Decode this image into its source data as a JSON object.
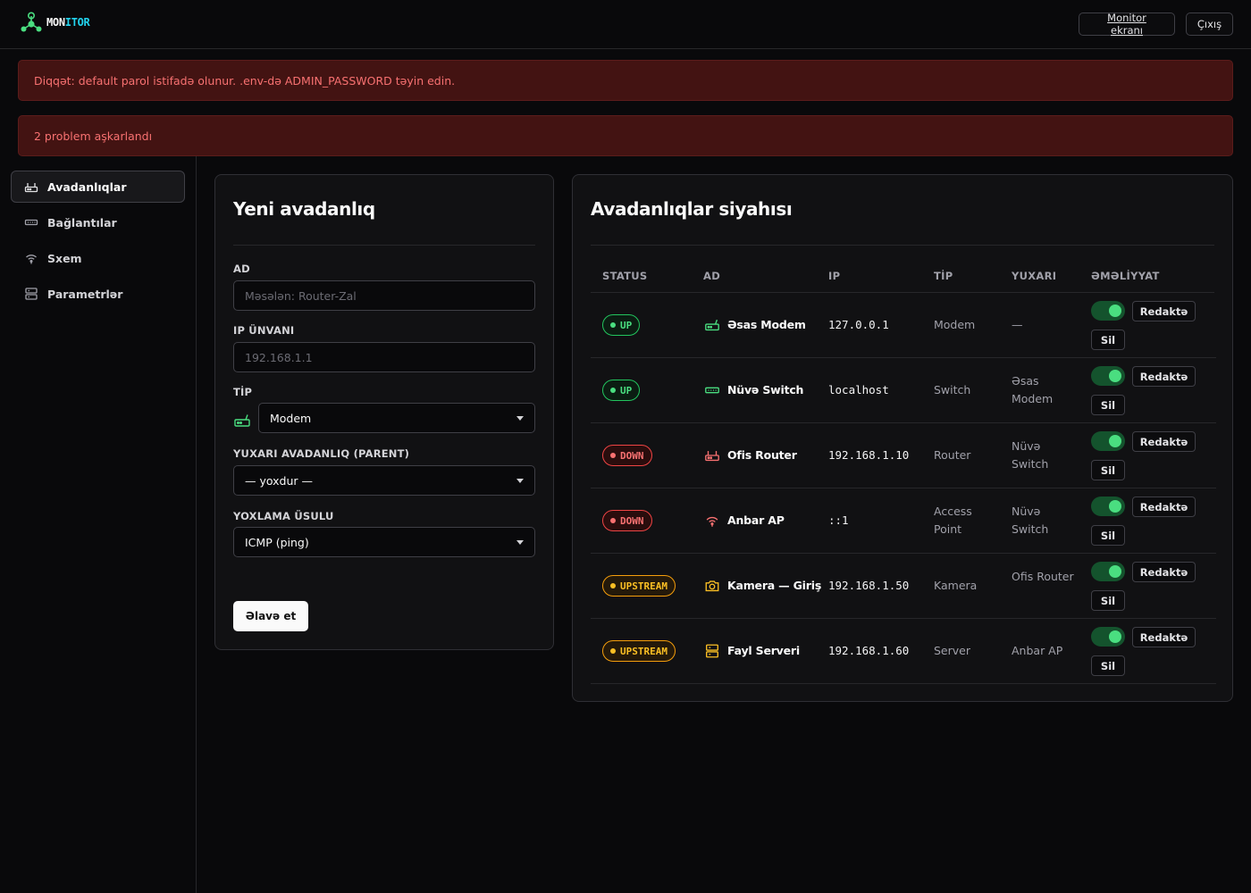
{
  "app": {
    "logo_part1": "MON",
    "logo_part2": "ITOR"
  },
  "topbar": {
    "monitor_label": "Monitor ekranı",
    "logout_label": "Çıxış"
  },
  "alerts": [
    "Diqqət: default parol istifadə olunur. .env-də ADMIN_PASSWORD təyin edin.",
    "2 problem aşkarlandı"
  ],
  "sidebar": {
    "items": [
      {
        "label": "Avadanlıqlar",
        "icon": "router-icon",
        "active": true
      },
      {
        "label": "Bağlantılar",
        "icon": "switch-icon",
        "active": false
      },
      {
        "label": "Sxem",
        "icon": "wifi-icon",
        "active": false
      },
      {
        "label": "Parametrlər",
        "icon": "server-icon",
        "active": false
      }
    ]
  },
  "form": {
    "title": "Yeni avadanlıq",
    "name_label": "AD",
    "name_placeholder": "Məsələn: Router-Zal",
    "ip_label": "IP ÜNVANI",
    "ip_placeholder": "192.168.1.1",
    "type_label": "TİP",
    "type_value": "Modem",
    "parent_label": "YUXARI AVADANLIQ (PARENT)",
    "parent_value": "— yoxdur —",
    "check_label": "YOXLAMA ÜSULU",
    "check_value": "ICMP (ping)",
    "submit_label": "Əlavə et"
  },
  "list": {
    "title": "Avadanlıqlar siyahısı",
    "columns": [
      "STATUS",
      "AD",
      "IP",
      "TİP",
      "YUXARI",
      "ƏMƏLİYYAT"
    ],
    "edit_label": "Redaktə",
    "delete_label": "Sil",
    "rows": [
      {
        "status": "UP",
        "status_kind": "up",
        "name": "Əsas Modem",
        "icon": "modem-icon",
        "ip": "127.0.0.1",
        "type": "Modem",
        "parent": "—",
        "enabled": true
      },
      {
        "status": "UP",
        "status_kind": "up",
        "name": "Nüvə Switch",
        "icon": "switch-icon",
        "ip": "localhost",
        "type": "Switch",
        "parent": "Əsas Modem",
        "enabled": true
      },
      {
        "status": "DOWN",
        "status_kind": "down",
        "name": "Ofis Router",
        "icon": "router-icon",
        "ip": "192.168.1.10",
        "type": "Router",
        "parent": "Nüvə Switch",
        "enabled": true
      },
      {
        "status": "DOWN",
        "status_kind": "down",
        "name": "Anbar AP",
        "icon": "wifi-icon",
        "ip": "::1",
        "type": "Access Point",
        "parent": "Nüvə Switch",
        "enabled": true
      },
      {
        "status": "UPSTREAM",
        "status_kind": "upstream",
        "name": "Kamera — Giriş",
        "icon": "camera-icon",
        "ip": "192.168.1.50",
        "type": "Kamera",
        "parent": "Ofis Router",
        "enabled": true
      },
      {
        "status": "UPSTREAM",
        "status_kind": "upstream",
        "name": "Fayl Serveri",
        "icon": "server-icon",
        "ip": "192.168.1.60",
        "type": "Server",
        "parent": "Anbar AP",
        "enabled": true
      }
    ]
  },
  "colors": {
    "accent_green": "#4ade80",
    "danger": "#f87171",
    "warning": "#fbbf24",
    "logo_cyan": "#22d3ee"
  }
}
